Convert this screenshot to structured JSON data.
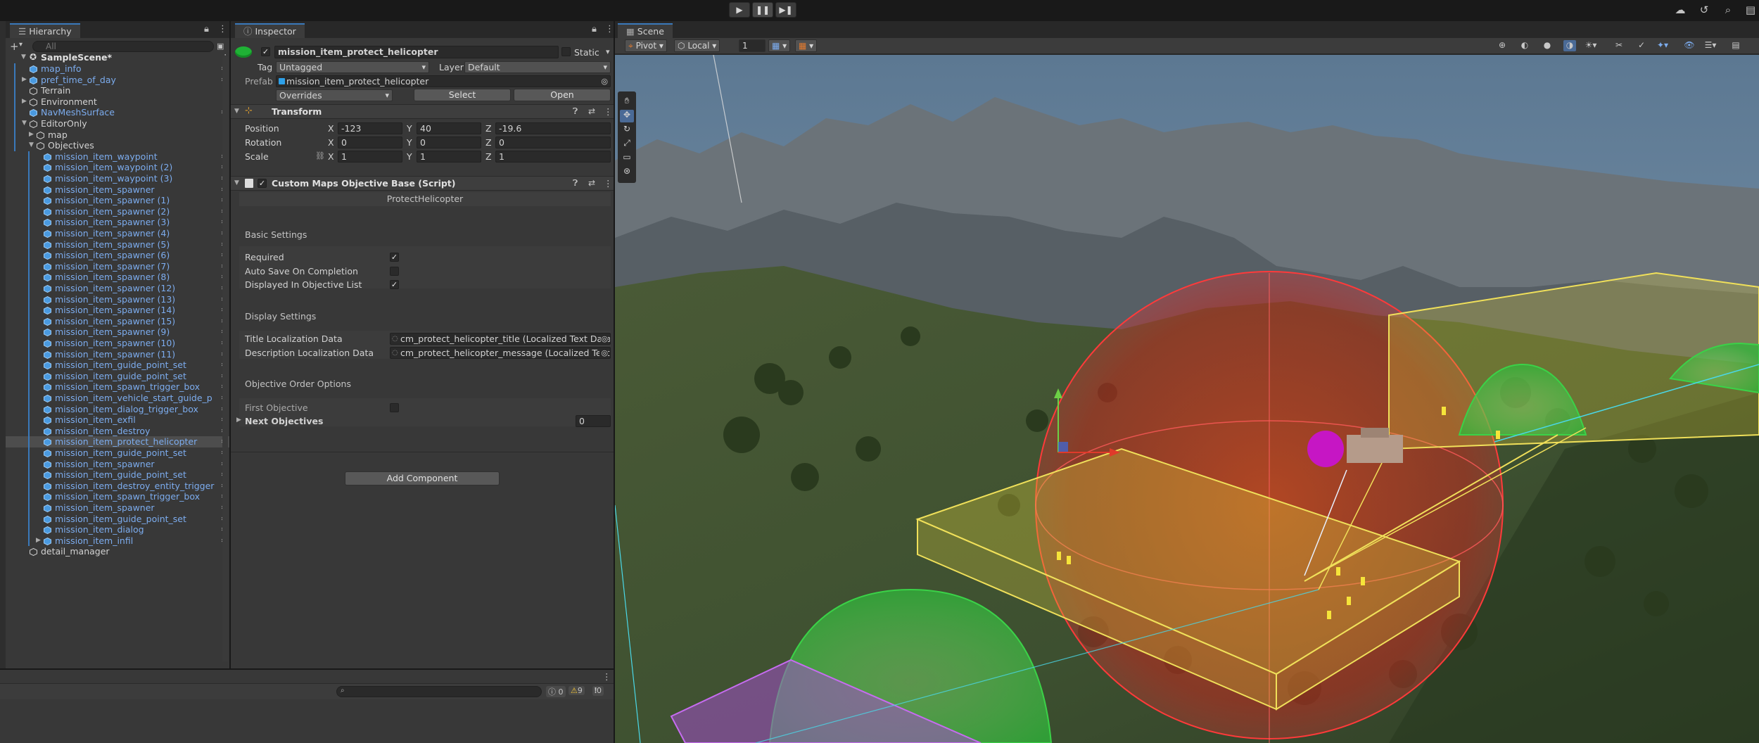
{
  "toolbar": {
    "play_icon": "play-icon",
    "pause_icon": "pause-icon",
    "step_icon": "step-icon",
    "right_icons": [
      "cloud-icon",
      "history-icon",
      "search-icon",
      "layout-icon"
    ]
  },
  "hierarchy": {
    "tab_label": "Hierarchy",
    "add_label": "+",
    "search_placeholder": "All",
    "scene_name": "SampleScene*",
    "items": [
      {
        "label": "map_info",
        "depth": 1,
        "color": "blue",
        "fold": false
      },
      {
        "label": "pref_time_of_day",
        "depth": 1,
        "color": "blue",
        "fold": true
      },
      {
        "label": "Terrain",
        "depth": 1,
        "color": "grey",
        "fold": false
      },
      {
        "label": "Environment",
        "depth": 1,
        "color": "grey",
        "fold": true
      },
      {
        "label": "NavMeshSurface",
        "depth": 1,
        "color": "blue",
        "fold": false
      },
      {
        "label": "EditorOnly",
        "depth": 1,
        "color": "grey",
        "fold": true,
        "open": true
      },
      {
        "label": "map",
        "depth": 2,
        "color": "grey",
        "fold": true
      },
      {
        "label": "Objectives",
        "depth": 2,
        "color": "grey",
        "fold": true,
        "open": true
      },
      {
        "label": "mission_item_waypoint",
        "depth": 3,
        "color": "blue"
      },
      {
        "label": "mission_item_waypoint (2)",
        "depth": 3,
        "color": "blue"
      },
      {
        "label": "mission_item_waypoint (3)",
        "depth": 3,
        "color": "blue"
      },
      {
        "label": "mission_item_spawner",
        "depth": 3,
        "color": "blue"
      },
      {
        "label": "mission_item_spawner (1)",
        "depth": 3,
        "color": "blue"
      },
      {
        "label": "mission_item_spawner (2)",
        "depth": 3,
        "color": "blue"
      },
      {
        "label": "mission_item_spawner (3)",
        "depth": 3,
        "color": "blue"
      },
      {
        "label": "mission_item_spawner (4)",
        "depth": 3,
        "color": "blue"
      },
      {
        "label": "mission_item_spawner (5)",
        "depth": 3,
        "color": "blue"
      },
      {
        "label": "mission_item_spawner (6)",
        "depth": 3,
        "color": "blue"
      },
      {
        "label": "mission_item_spawner (7)",
        "depth": 3,
        "color": "blue"
      },
      {
        "label": "mission_item_spawner (8)",
        "depth": 3,
        "color": "blue"
      },
      {
        "label": "mission_item_spawner (12)",
        "depth": 3,
        "color": "blue"
      },
      {
        "label": "mission_item_spawner (13)",
        "depth": 3,
        "color": "blue"
      },
      {
        "label": "mission_item_spawner (14)",
        "depth": 3,
        "color": "blue"
      },
      {
        "label": "mission_item_spawner (15)",
        "depth": 3,
        "color": "blue"
      },
      {
        "label": "mission_item_spawner (9)",
        "depth": 3,
        "color": "blue"
      },
      {
        "label": "mission_item_spawner (10)",
        "depth": 3,
        "color": "blue"
      },
      {
        "label": "mission_item_spawner (11)",
        "depth": 3,
        "color": "blue"
      },
      {
        "label": "mission_item_guide_point_set",
        "depth": 3,
        "color": "blue"
      },
      {
        "label": "mission_item_guide_point_set",
        "depth": 3,
        "color": "blue"
      },
      {
        "label": "mission_item_spawn_trigger_box",
        "depth": 3,
        "color": "blue"
      },
      {
        "label": "mission_item_vehicle_start_guide_p",
        "depth": 3,
        "color": "blue"
      },
      {
        "label": "mission_item_dialog_trigger_box",
        "depth": 3,
        "color": "blue"
      },
      {
        "label": "mission_item_exfil",
        "depth": 3,
        "color": "blue"
      },
      {
        "label": "mission_item_destroy",
        "depth": 3,
        "color": "blue"
      },
      {
        "label": "mission_item_protect_helicopter",
        "depth": 3,
        "color": "blue",
        "selected": true
      },
      {
        "label": "mission_item_guide_point_set",
        "depth": 3,
        "color": "blue"
      },
      {
        "label": "mission_item_spawner",
        "depth": 3,
        "color": "blue"
      },
      {
        "label": "mission_item_guide_point_set",
        "depth": 3,
        "color": "blue"
      },
      {
        "label": "mission_item_destroy_entity_trigger",
        "depth": 3,
        "color": "blue"
      },
      {
        "label": "mission_item_spawn_trigger_box",
        "depth": 3,
        "color": "blue"
      },
      {
        "label": "mission_item_spawner",
        "depth": 3,
        "color": "blue"
      },
      {
        "label": "mission_item_guide_point_set",
        "depth": 3,
        "color": "blue"
      },
      {
        "label": "mission_item_dialog",
        "depth": 3,
        "color": "blue"
      },
      {
        "label": "mission_item_infil",
        "depth": 3,
        "color": "blue",
        "fold": true
      },
      {
        "label": "detail_manager",
        "depth": 1,
        "color": "grey"
      }
    ]
  },
  "inspector": {
    "tab_label": "Inspector",
    "object_name": "mission_item_protect_helicopter",
    "static_label": "Static",
    "tag_label": "Tag",
    "tag_value": "Untagged",
    "layer_label": "Layer",
    "layer_value": "Default",
    "prefab_label": "Prefab",
    "prefab_value": "mission_item_protect_helicopter",
    "overrides_label": "Overrides",
    "select_label": "Select",
    "open_label": "Open",
    "transform": {
      "title": "Transform",
      "position_label": "Position",
      "rotation_label": "Rotation",
      "scale_label": "Scale",
      "position": {
        "x": "-123",
        "y": "40",
        "z": "-19.6"
      },
      "rotation": {
        "x": "0",
        "y": "0",
        "z": "0"
      },
      "scale": {
        "x": "1",
        "y": "1",
        "z": "1"
      },
      "axis_x": "X",
      "axis_y": "Y",
      "axis_z": "Z"
    },
    "script": {
      "title": "Custom Maps Objective Base (Script)",
      "type_value": "ProtectHelicopter",
      "basic_settings": "Basic Settings",
      "required_label": "Required",
      "required": true,
      "auto_save_label": "Auto Save On Completion",
      "auto_save": false,
      "displayed_label": "Displayed In Objective List",
      "displayed": true,
      "display_settings": "Display Settings",
      "title_loc_label": "Title Localization Data",
      "title_loc_value": "cm_protect_helicopter_title (Localized Text Data)",
      "desc_loc_label": "Description Localization Data",
      "desc_loc_value": "cm_protect_helicopter_message (Localized Text",
      "order_options": "Objective Order Options",
      "first_objective_label": "First Objective",
      "first_objective": false,
      "next_objectives_label": "Next Objectives",
      "next_objectives_value": "0"
    },
    "add_component_label": "Add Component"
  },
  "scene": {
    "tab_label": "Scene",
    "pivot_label": "Pivot",
    "local_label": "Local",
    "grid_value": "1"
  },
  "console": {
    "log_count": "0",
    "warn_count": "9",
    "error_count": "0"
  },
  "colors": {
    "accent": "#3a79bb",
    "prefab_blue": "#7cacee",
    "panel_bg": "#383838"
  }
}
